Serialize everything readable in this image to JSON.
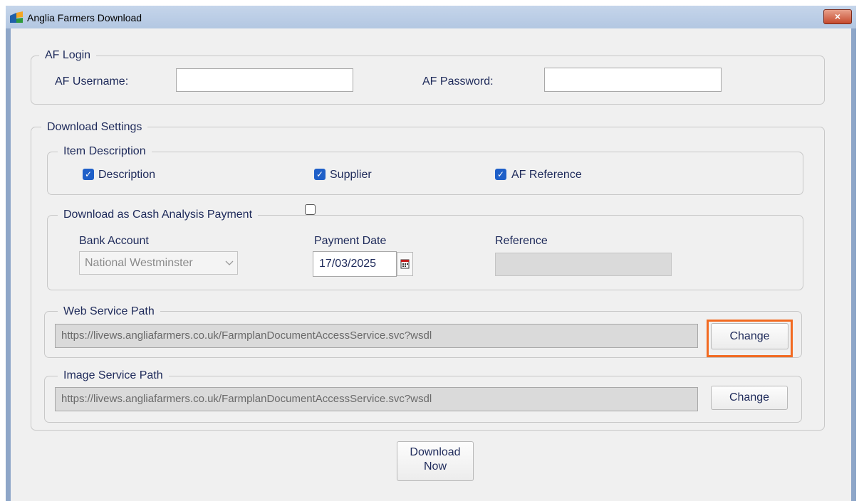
{
  "window": {
    "title": "Anglia Farmers Download",
    "close_label": "×"
  },
  "login": {
    "legend": "AF Login",
    "username_label": "AF Username:",
    "username_value": "",
    "password_label": "AF Password:",
    "password_value": ""
  },
  "download_settings": {
    "legend": "Download Settings"
  },
  "item_description": {
    "legend": "Item Description",
    "options": [
      {
        "label": "Description",
        "checked": true
      },
      {
        "label": "Supplier",
        "checked": true
      },
      {
        "label": "AF Reference",
        "checked": true
      }
    ]
  },
  "cash_analysis": {
    "legend": "Download as Cash Analysis Payment",
    "checked": false,
    "bank_account_label": "Bank Account",
    "bank_account_value": "National Westminster",
    "payment_date_label": "Payment Date",
    "payment_date_value": "17/03/2025",
    "reference_label": "Reference",
    "reference_value": ""
  },
  "web_service": {
    "legend": "Web Service Path",
    "path": "https://livews.angliafarmers.co.uk/FarmplanDocumentAccessService.svc?wsdl",
    "change_label": "Change"
  },
  "image_service": {
    "legend": "Image Service Path",
    "path": "https://livews.angliafarmers.co.uk/FarmplanDocumentAccessService.svc?wsdl",
    "change_label": "Change"
  },
  "download_button": {
    "line1": "Download",
    "line2": "Now"
  },
  "colors": {
    "highlight": "#f26a21",
    "checkbox": "#1e5fc8",
    "label_text": "#1e2a5a"
  }
}
